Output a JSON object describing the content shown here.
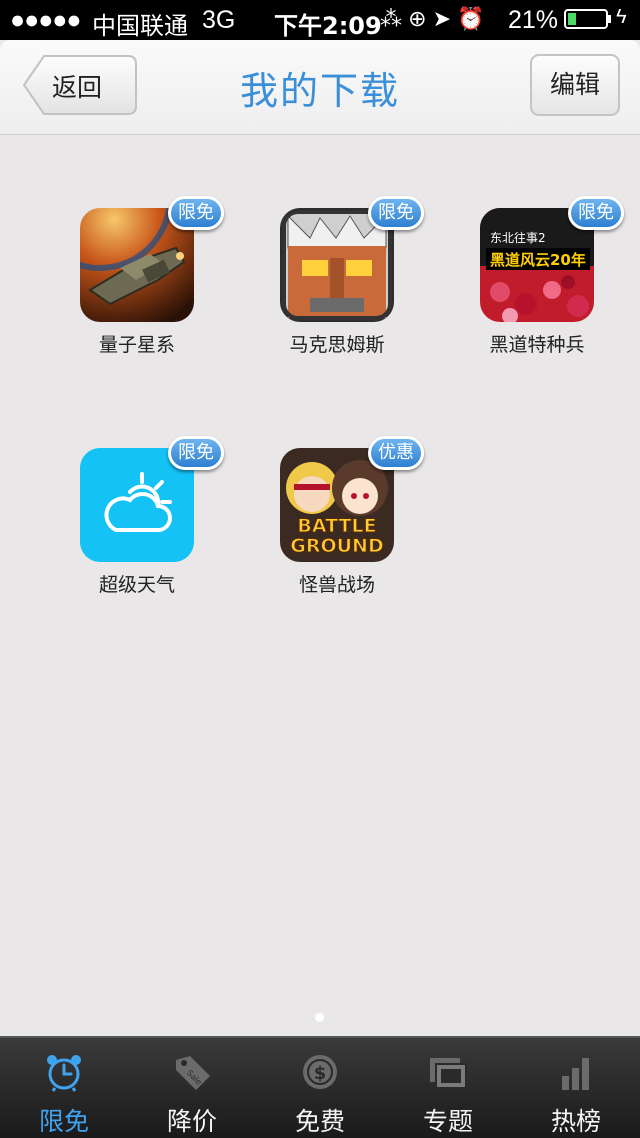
{
  "status_bar": {
    "signal": "●●●●●",
    "carrier": "中国联通",
    "network": "3G",
    "time": "下午2:09",
    "icons": "⁂ ⊕ ➤ ⏰",
    "battery_pct": "21%",
    "battery_level": 0.21
  },
  "nav": {
    "back_label": "返回",
    "title": "我的下载",
    "edit_label": "编辑"
  },
  "apps": [
    {
      "name": "量子星系",
      "badge": "限免",
      "icon": "spaceship-icon"
    },
    {
      "name": "马克思姆斯",
      "badge": "限免",
      "icon": "warrior-face-icon"
    },
    {
      "name": "黑道特种兵",
      "badge": "限免",
      "icon": "book-cover-icon",
      "cover_top": "东北往事2",
      "cover_main": "黑道风云20年"
    },
    {
      "name": "超级天气",
      "badge": "限免",
      "icon": "weather-cloud-sun-icon"
    },
    {
      "name": "怪兽战场",
      "badge": "优惠",
      "icon": "battle-ground-icon",
      "cover_line1": "BATTLE",
      "cover_line2": "GROUND"
    }
  ],
  "pagination": {
    "current": 1,
    "total": 1
  },
  "tabs": [
    {
      "label": "限免",
      "icon": "alarm-clock-icon",
      "active": true
    },
    {
      "label": "降价",
      "icon": "sale-tag-icon",
      "active": false
    },
    {
      "label": "免费",
      "icon": "dollar-coin-icon",
      "active": false
    },
    {
      "label": "专题",
      "icon": "picture-frames-icon",
      "active": false
    },
    {
      "label": "热榜",
      "icon": "bar-chart-icon",
      "active": false
    }
  ],
  "colors": {
    "accent": "#3a8fd8",
    "active_tab": "#3fa3f0",
    "background": "#e9e7e8",
    "badge": "#2d7fd2"
  }
}
